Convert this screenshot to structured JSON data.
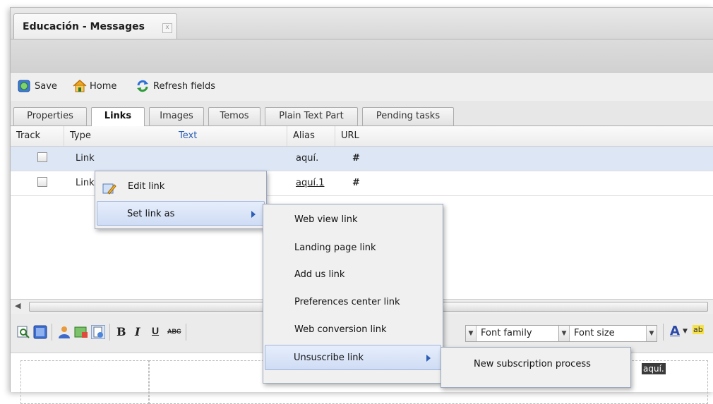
{
  "window": {
    "tab_title": "Educación - Messages",
    "tab_close": "x"
  },
  "toolbar": {
    "save_label": "Save",
    "home_label": "Home",
    "refresh_label": "Refresh fields"
  },
  "subtabs": [
    "Properties",
    "Links",
    "Images",
    "Temos",
    "Plain Text Part",
    "Pending tasks"
  ],
  "active_subtab": "Links",
  "grid": {
    "columns": [
      "Track",
      "Type",
      "Text",
      "Alias",
      "URL"
    ],
    "rows": [
      {
        "type": "Link",
        "text": "",
        "alias": "aquí.",
        "url": "#",
        "selected": true
      },
      {
        "type": "Link",
        "text": "",
        "alias": "aquí.1",
        "url": "#",
        "selected": false
      }
    ]
  },
  "context_menu": {
    "items": [
      "Edit link",
      "Set link as"
    ]
  },
  "submenu": {
    "items": [
      "Web view link",
      "Landing page link",
      "Add us link",
      "Preferences center link",
      "Web conversion link",
      "Unsuscribe link"
    ]
  },
  "submenu2": {
    "items": [
      "New subscription process"
    ]
  },
  "editor": {
    "bold": "B",
    "italic": "I",
    "underline": "U",
    "strike": "ABC",
    "font_family": "Font family",
    "font_size": "Font size",
    "text_color": "A",
    "highlight": "ab"
  },
  "canvas": {
    "highlighted_text": "aquí."
  },
  "colors": {
    "selection_row": "#dce6f5",
    "menu_highlight": "#cfdcf4",
    "link_header": "#2b5eb5"
  }
}
